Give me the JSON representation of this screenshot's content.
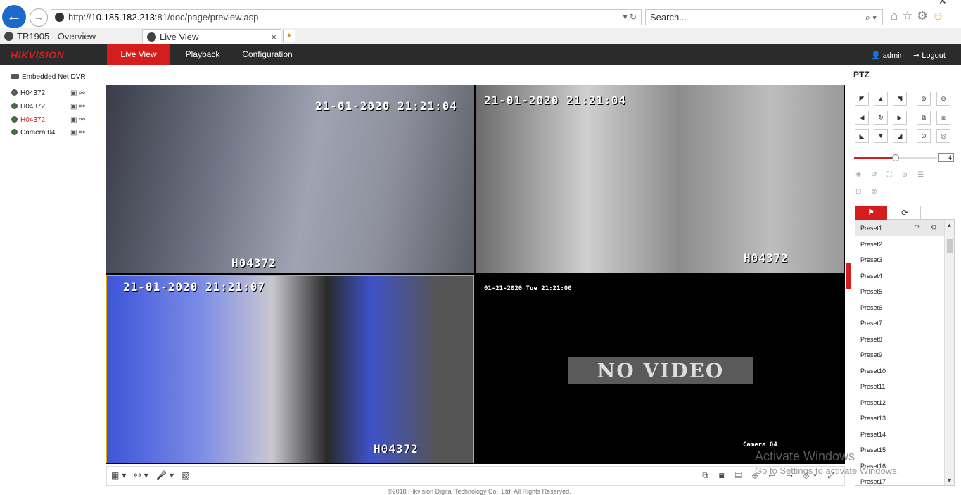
{
  "browser": {
    "url_prefix": "http://",
    "url_host": "10.185.182.213",
    "url_rest": ":81/doc/page/preview.asp",
    "url_controls": "▾ ↻",
    "search_placeholder": "Search...",
    "search_controls": "⌕ ▾",
    "back_glyph": "←",
    "forward_glyph": "→",
    "tools": [
      "⌂",
      "☆",
      "⚙",
      "☺"
    ],
    "close_glyph": "✕",
    "tabs": [
      {
        "label": "TR1905 - Overview"
      },
      {
        "label": "Live View"
      }
    ],
    "tab_close": "×",
    "new_tab_glyph": "✦"
  },
  "app": {
    "logo": "HIKVISION",
    "nav": [
      "Live View",
      "Playback",
      "Configuration"
    ],
    "user": "admin",
    "logout": "Logout",
    "user_icon": "person-icon",
    "logout_icon": "logout-icon"
  },
  "tree": {
    "root": "Embedded Net DVR",
    "cameras": [
      {
        "name": "H04372",
        "selected": false
      },
      {
        "name": "H04372",
        "selected": false
      },
      {
        "name": "H04372",
        "selected": true
      },
      {
        "name": "Camera 04",
        "selected": false
      }
    ],
    "cam_actions": "▣⚯"
  },
  "views": {
    "tile1": {
      "time": "21-01-2020 21:21:04",
      "label": "H04372"
    },
    "tile2": {
      "time": "21-01-2020 21:21:04",
      "label": "H04372"
    },
    "tile3": {
      "time": "21-01-2020 21:21:07",
      "label": "H04372"
    },
    "tile4": {
      "time": "01-21-2020 Tue 21:21:00",
      "no_video": "NO VIDEO",
      "label": "Camera 04"
    }
  },
  "toolbar": {
    "left": "▦▾ ⚯▾ 🎤▾ ▧",
    "right": "⧉ ◙ ▤ ⊕ ↩ ↪ ⊘▾ ⤢"
  },
  "footer": "©2018 Hikvision Digital Technology Co., Ltd. All Rights Reserved.",
  "ptz": {
    "title": "PTZ",
    "dir_buttons": [
      "◤",
      "▲",
      "◥",
      "◀",
      "↻",
      "▶",
      "◣",
      "▼",
      "◢"
    ],
    "zoom_buttons": [
      "⊕",
      "⊖",
      "⧉",
      "⧈",
      "⊙",
      "◎"
    ],
    "speed": "4",
    "speed_fraction": 0.5,
    "tab_preset": "⚑",
    "tab_patrol": "⟳",
    "preset_actions": "↷ ⚙",
    "presets": [
      "Preset1",
      "Preset2",
      "Preset3",
      "Preset4",
      "Preset5",
      "Preset6",
      "Preset7",
      "Preset8",
      "Preset9",
      "Preset10",
      "Preset11",
      "Preset12",
      "Preset13",
      "Preset14",
      "Preset15",
      "Preset16",
      "Preset17"
    ]
  },
  "watermark": {
    "line1": "Activate Windows",
    "line2": "Go to Settings to activate Windows."
  }
}
